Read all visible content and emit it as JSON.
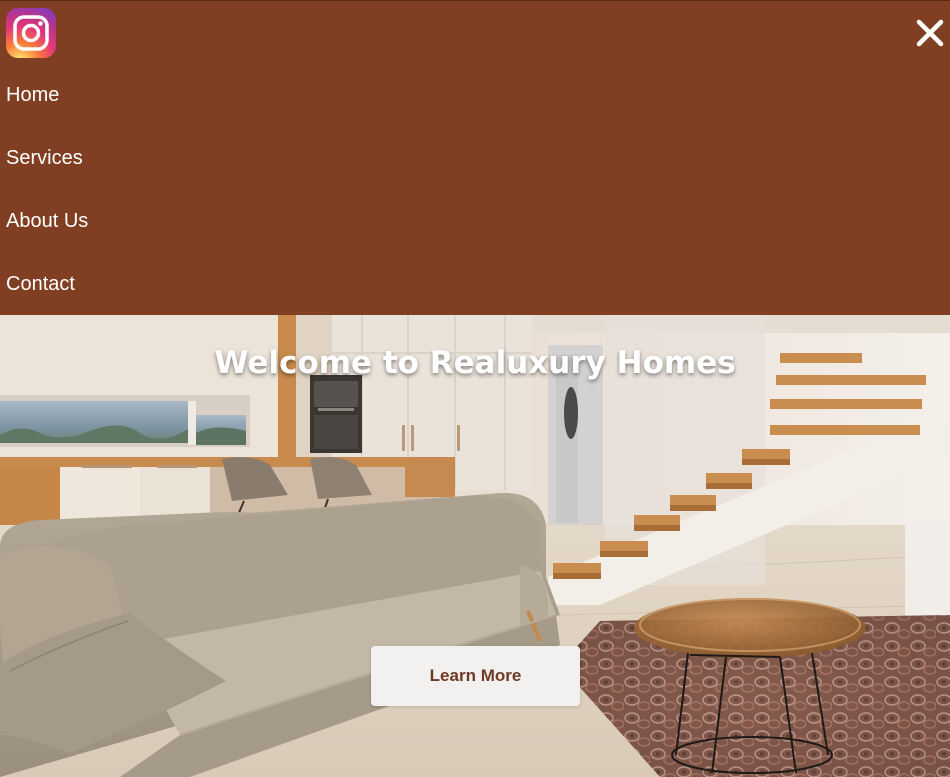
{
  "nav": {
    "items": [
      {
        "label": "Home"
      },
      {
        "label": "Services"
      },
      {
        "label": "About Us"
      },
      {
        "label": "Contact"
      }
    ],
    "logo_icon": "instagram-icon",
    "close_icon": "close-icon",
    "background": "#803f22"
  },
  "hero": {
    "title": "Welcome to Realuxury Homes",
    "cta_label": "Learn More"
  },
  "colors": {
    "nav_background": "#803f22",
    "cta_background": "#f3f1f0",
    "cta_text": "#6e3a23",
    "nav_text": "#ffffff"
  }
}
